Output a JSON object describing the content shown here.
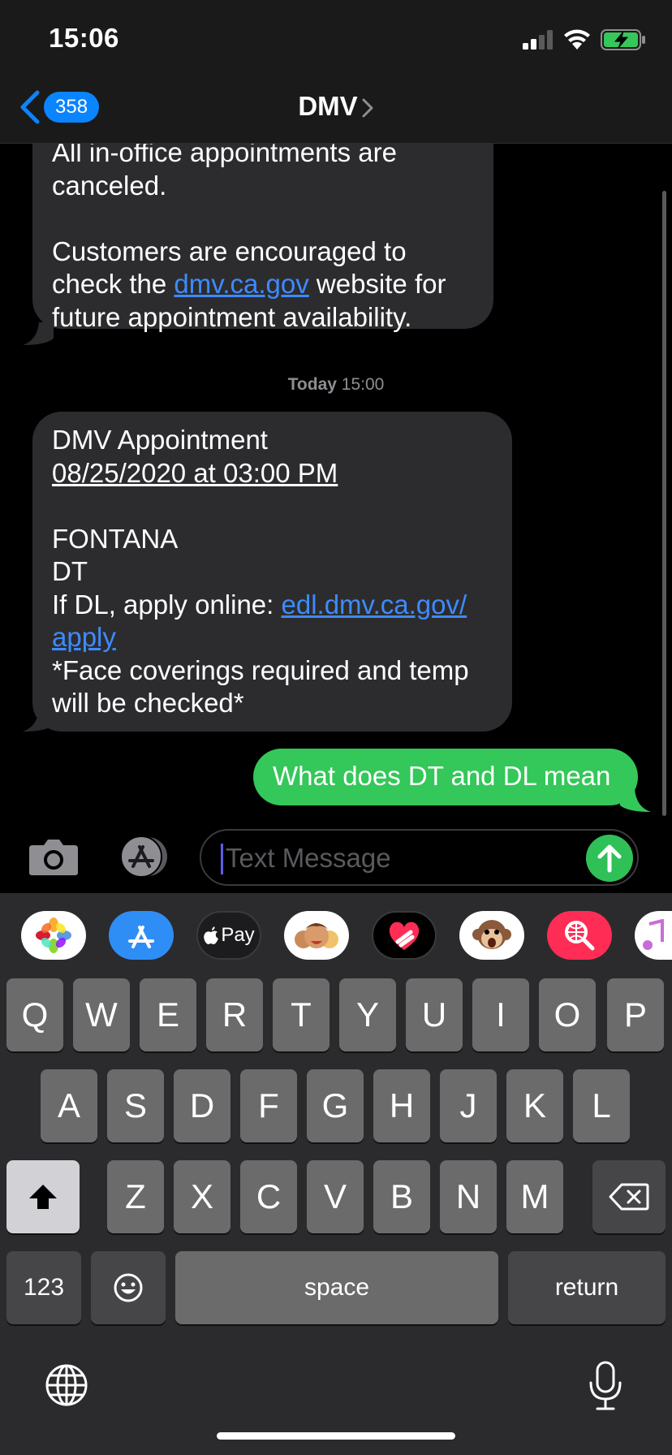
{
  "status_bar": {
    "time": "15:06"
  },
  "nav": {
    "back_count": "358",
    "title": "DMV"
  },
  "messages": [
    {
      "direction": "incoming",
      "lines": [
        "All in-office appointments are",
        "canceled.",
        "",
        "Customers are encouraged to",
        "check the ",
        "website for",
        "future appointment availability."
      ],
      "link": "dmv.ca.gov"
    },
    {
      "type": "timestamp",
      "day": "Today",
      "time": "15:00"
    },
    {
      "direction": "incoming",
      "title": "DMV Appointment",
      "datetime": "08/25/2020 at 03:00 PM",
      "location_1": "FONTANA",
      "location_2": "DT",
      "dl_prefix": "If DL, apply online: ",
      "dl_link_1": "edl.dmv.ca.gov/",
      "dl_link_2": "apply",
      "note_1": "*Face coverings required and temp",
      "note_2": "will be checked*"
    },
    {
      "direction": "outgoing",
      "text": "What does DT and DL mean"
    }
  ],
  "composer": {
    "placeholder": "Text Message"
  },
  "app_drawer": [
    "photos-app",
    "app-store-app",
    "apple-pay-app",
    "memoji-app",
    "digital-touch-app",
    "animoji-app",
    "images-search-app",
    "music-app"
  ],
  "app_drawer_labels": {
    "apple_pay": "Pay"
  },
  "keyboard": {
    "row1": [
      "Q",
      "W",
      "E",
      "R",
      "T",
      "Y",
      "U",
      "I",
      "O",
      "P"
    ],
    "row2": [
      "A",
      "S",
      "D",
      "F",
      "G",
      "H",
      "J",
      "K",
      "L"
    ],
    "row3": [
      "Z",
      "X",
      "C",
      "V",
      "B",
      "N",
      "M"
    ],
    "numbers": "123",
    "space": "space",
    "return": "return"
  },
  "colors": {
    "incoming_bubble": "#2c2c2e",
    "outgoing_bubble": "#34c759",
    "link": "#3d8bff",
    "badge": "#0a84ff"
  }
}
